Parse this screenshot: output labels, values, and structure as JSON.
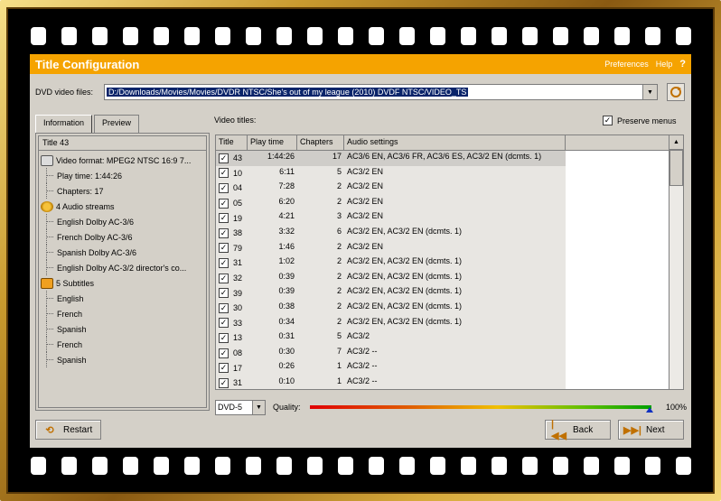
{
  "app": {
    "title": "Title Configuration",
    "links": {
      "preferences": "Preferences",
      "help": "Help",
      "help_q": "?"
    }
  },
  "dvd_files": {
    "label": "DVD video files:",
    "path": "D:/Downloads/Movies/Movies/DVDR NTSC/She's out of my league (2010) DVDF NTSC/VIDEO_TS"
  },
  "tabs": [
    {
      "label": "Information"
    },
    {
      "label": "Preview"
    }
  ],
  "info": {
    "header": "Title 43",
    "tree": [
      {
        "label": "Video format: MPEG2 NTSC 16:9 7...",
        "level": 0,
        "icon": "video-icon"
      },
      {
        "label": "Play time: 1:44:26",
        "level": 1
      },
      {
        "label": "Chapters: 17",
        "level": 1
      },
      {
        "label": "4 Audio streams",
        "level": 0,
        "icon": "audio-icon"
      },
      {
        "label": "English Dolby AC-3/6",
        "level": 1
      },
      {
        "label": "French Dolby AC-3/6",
        "level": 1
      },
      {
        "label": "Spanish Dolby AC-3/6",
        "level": 1
      },
      {
        "label": "English Dolby AC-3/2 director's co...",
        "level": 1
      },
      {
        "label": "5 Subtitles",
        "level": 0,
        "icon": "subtitles-icon"
      },
      {
        "label": "English",
        "level": 1
      },
      {
        "label": "French",
        "level": 1
      },
      {
        "label": "Spanish",
        "level": 1
      },
      {
        "label": "French",
        "level": 1
      },
      {
        "label": "Spanish",
        "level": 1
      }
    ]
  },
  "video_titles": {
    "label": "Video titles:",
    "preserve_menus": "Preserve menus",
    "preserve_checked": true,
    "columns": [
      "Title",
      "Play time",
      "Chapters",
      "Audio settings"
    ],
    "rows": [
      {
        "title": "43",
        "time": "1:44:26",
        "chapters": "17",
        "audio": "AC3/6 EN, AC3/6 FR, AC3/6 ES, AC3/2 EN (dcmts. 1)",
        "checked": true,
        "selected": true
      },
      {
        "title": "10",
        "time": "6:11",
        "chapters": "5",
        "audio": "AC3/2 EN",
        "checked": true
      },
      {
        "title": "04",
        "time": "7:28",
        "chapters": "2",
        "audio": "AC3/2 EN",
        "checked": true
      },
      {
        "title": "05",
        "time": "6:20",
        "chapters": "2",
        "audio": "AC3/2 EN",
        "checked": true
      },
      {
        "title": "19",
        "time": "4:21",
        "chapters": "3",
        "audio": "AC3/2 EN",
        "checked": true
      },
      {
        "title": "38",
        "time": "3:32",
        "chapters": "6",
        "audio": "AC3/2 EN, AC3/2 EN (dcmts. 1)",
        "checked": true
      },
      {
        "title": "79",
        "time": "1:46",
        "chapters": "2",
        "audio": "AC3/2 EN",
        "checked": true
      },
      {
        "title": "31",
        "time": "1:02",
        "chapters": "2",
        "audio": "AC3/2 EN, AC3/2 EN (dcmts. 1)",
        "checked": true
      },
      {
        "title": "32",
        "time": "0:39",
        "chapters": "2",
        "audio": "AC3/2 EN, AC3/2 EN (dcmts. 1)",
        "checked": true
      },
      {
        "title": "39",
        "time": "0:39",
        "chapters": "2",
        "audio": "AC3/2 EN, AC3/2 EN (dcmts. 1)",
        "checked": true
      },
      {
        "title": "30",
        "time": "0:38",
        "chapters": "2",
        "audio": "AC3/2 EN, AC3/2 EN (dcmts. 1)",
        "checked": true
      },
      {
        "title": "33",
        "time": "0:34",
        "chapters": "2",
        "audio": "AC3/2 EN, AC3/2 EN (dcmts. 1)",
        "checked": true
      },
      {
        "title": "13",
        "time": "0:31",
        "chapters": "5",
        "audio": "AC3/2",
        "checked": true
      },
      {
        "title": "08",
        "time": "0:30",
        "chapters": "7",
        "audio": "AC3/2 --",
        "checked": true
      },
      {
        "title": "17",
        "time": "0:26",
        "chapters": "1",
        "audio": "AC3/2 --",
        "checked": true
      },
      {
        "title": "31",
        "time": "0:10",
        "chapters": "1",
        "audio": "AC3/2 --",
        "checked": true
      }
    ]
  },
  "quality": {
    "disc": "DVD-5",
    "label": "Quality:",
    "percent_text": "100%",
    "percent": 100
  },
  "buttons": {
    "restart": "Restart",
    "back": "Back",
    "next": "Next"
  },
  "colors": {
    "titlebar": "#f5a300",
    "selection": "#0a246a",
    "frame_gold": "#c99a2e"
  }
}
